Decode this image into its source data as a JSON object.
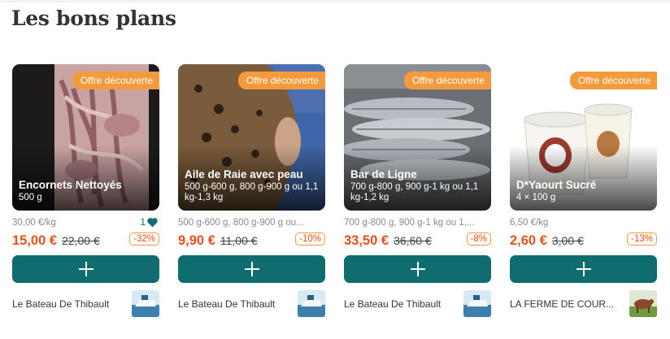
{
  "section": {
    "title": "Les bons plans"
  },
  "colors": {
    "accent": "#0f6d70",
    "price": "#e8501a",
    "badge": "#f39a3c"
  },
  "icons": {
    "add": "plus-icon",
    "like": "heart-icon"
  },
  "products": [
    {
      "badge": "Offre découverte",
      "name": "Encornets Nettoyés",
      "description": "500 g",
      "unit_line": "30,00 €/kg",
      "likes": "1",
      "price": "15,00 €",
      "old_price": "22,00 €",
      "discount": "-32%",
      "seller": "Le Bateau De Thibault"
    },
    {
      "badge": "Offre découverte",
      "name": "Aile de Raie avec peau",
      "description": "500 g-600 g, 800 g-900 g ou 1,1 kg-1,3 kg",
      "unit_line": "500 g-600 g, 800 g-900 g ou...",
      "price": "9,90 €",
      "old_price": "11,00 €",
      "discount": "-10%",
      "seller": "Le Bateau De Thibault"
    },
    {
      "badge": "Offre découverte",
      "name": "Bar de Ligne",
      "description": "700 g-800 g, 900 g-1 kg ou 1,1 kg-1,2 kg",
      "unit_line": "700 g-800 g, 900 g-1 kg ou 1,...",
      "price": "33,50 €",
      "old_price": "36,60 €",
      "discount": "-8%",
      "seller": "Le Bateau De Thibault"
    },
    {
      "badge": "Offre découverte",
      "name": "D*Yaourt Sucré",
      "description": "4 × 100 g",
      "unit_line": "6,50 €/kg",
      "price": "2,60 €",
      "old_price": "3,00 €",
      "discount": "-13%",
      "seller": "LA FERME DE COUR..."
    }
  ]
}
